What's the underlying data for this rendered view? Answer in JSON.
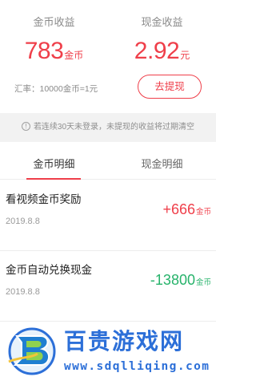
{
  "summary": {
    "coin": {
      "label": "金币收益",
      "amount": "783",
      "unit": "金币"
    },
    "cash": {
      "label": "现金收益",
      "amount": "2.92",
      "unit": "元"
    },
    "exchange_rate": "汇率：10000金币=1元",
    "withdraw_button": "去提现"
  },
  "notice": {
    "icon": "info-icon",
    "text": "若连续30天未登录，未提现的收益将过期清空"
  },
  "tabs": [
    {
      "label": "金币明细",
      "active": true
    },
    {
      "label": "现金明细",
      "active": false
    }
  ],
  "records": [
    {
      "title": "看视频金币奖励",
      "date": "2019.8.8",
      "amount": "+666",
      "unit": "金币",
      "direction": "income"
    },
    {
      "title": "金币自动兑换现金",
      "date": "2019.8.8",
      "amount": "-13800",
      "unit": "金币",
      "direction": "expense"
    }
  ],
  "watermark": {
    "title": "百贵游戏网",
    "url": "www.sdqlliqing.com"
  },
  "colors": {
    "accent": "#ef3f4a",
    "expense": "#27b36b",
    "watermark": "#2c6fd8"
  }
}
